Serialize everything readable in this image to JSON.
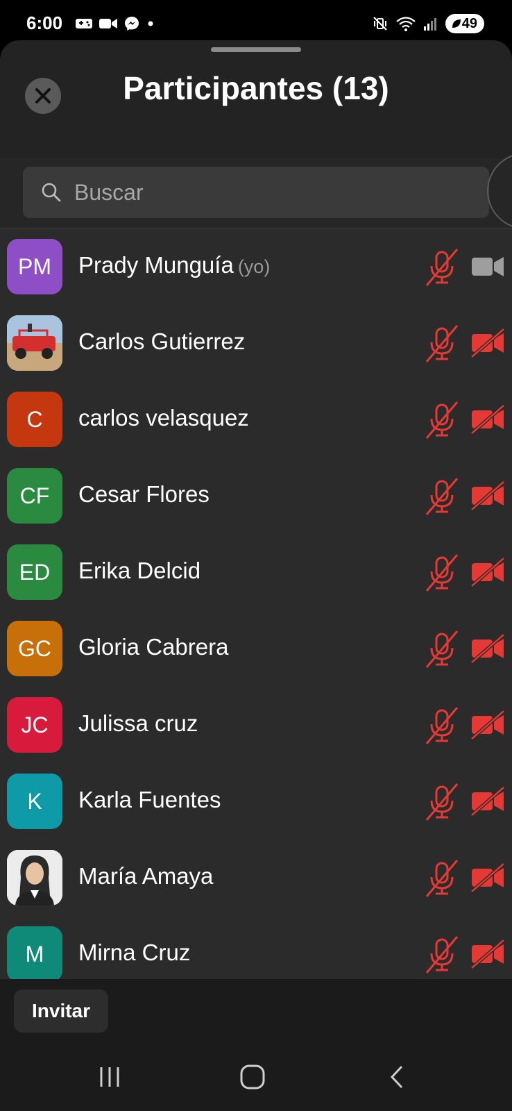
{
  "status_bar": {
    "time": "6:00",
    "battery": "49"
  },
  "sheet": {
    "title": "Participantes (13)"
  },
  "search": {
    "placeholder": "Buscar"
  },
  "participants": [
    {
      "initials": "PM",
      "name": "Prady Munguía",
      "suffix": "(yo)",
      "color": "#8e4fc6",
      "photo": "",
      "mic_muted": true,
      "video_off": false
    },
    {
      "initials": "",
      "name": "Carlos Gutierrez",
      "suffix": "",
      "color": "#c8d7e6",
      "photo": "red-jeep",
      "mic_muted": true,
      "video_off": true
    },
    {
      "initials": "C",
      "name": "carlos velasquez",
      "suffix": "",
      "color": "#c5380f",
      "photo": "",
      "mic_muted": true,
      "video_off": true
    },
    {
      "initials": "CF",
      "name": "Cesar Flores",
      "suffix": "",
      "color": "#2a8a3f",
      "photo": "",
      "mic_muted": true,
      "video_off": true
    },
    {
      "initials": "ED",
      "name": "Erika Delcid",
      "suffix": "",
      "color": "#2a8a3f",
      "photo": "",
      "mic_muted": true,
      "video_off": true
    },
    {
      "initials": "GC",
      "name": "Gloria Cabrera",
      "suffix": "",
      "color": "#c76f08",
      "photo": "",
      "mic_muted": true,
      "video_off": true
    },
    {
      "initials": "JC",
      "name": "Julissa cruz",
      "suffix": "",
      "color": "#d81b3c",
      "photo": "",
      "mic_muted": true,
      "video_off": true
    },
    {
      "initials": "K",
      "name": "Karla Fuentes",
      "suffix": "",
      "color": "#0e9aa7",
      "photo": "",
      "mic_muted": true,
      "video_off": true
    },
    {
      "initials": "",
      "name": "María Amaya",
      "suffix": "",
      "color": "#e8e8e8",
      "photo": "woman-portrait",
      "mic_muted": true,
      "video_off": true
    },
    {
      "initials": "M",
      "name": "Mirna Cruz",
      "suffix": "",
      "color": "#108a78",
      "photo": "",
      "mic_muted": true,
      "video_off": true
    }
  ],
  "footer": {
    "invite_label": "Invitar"
  },
  "colors": {
    "muted_red": "#e53935",
    "video_on_gray": "#9e9e9e"
  }
}
